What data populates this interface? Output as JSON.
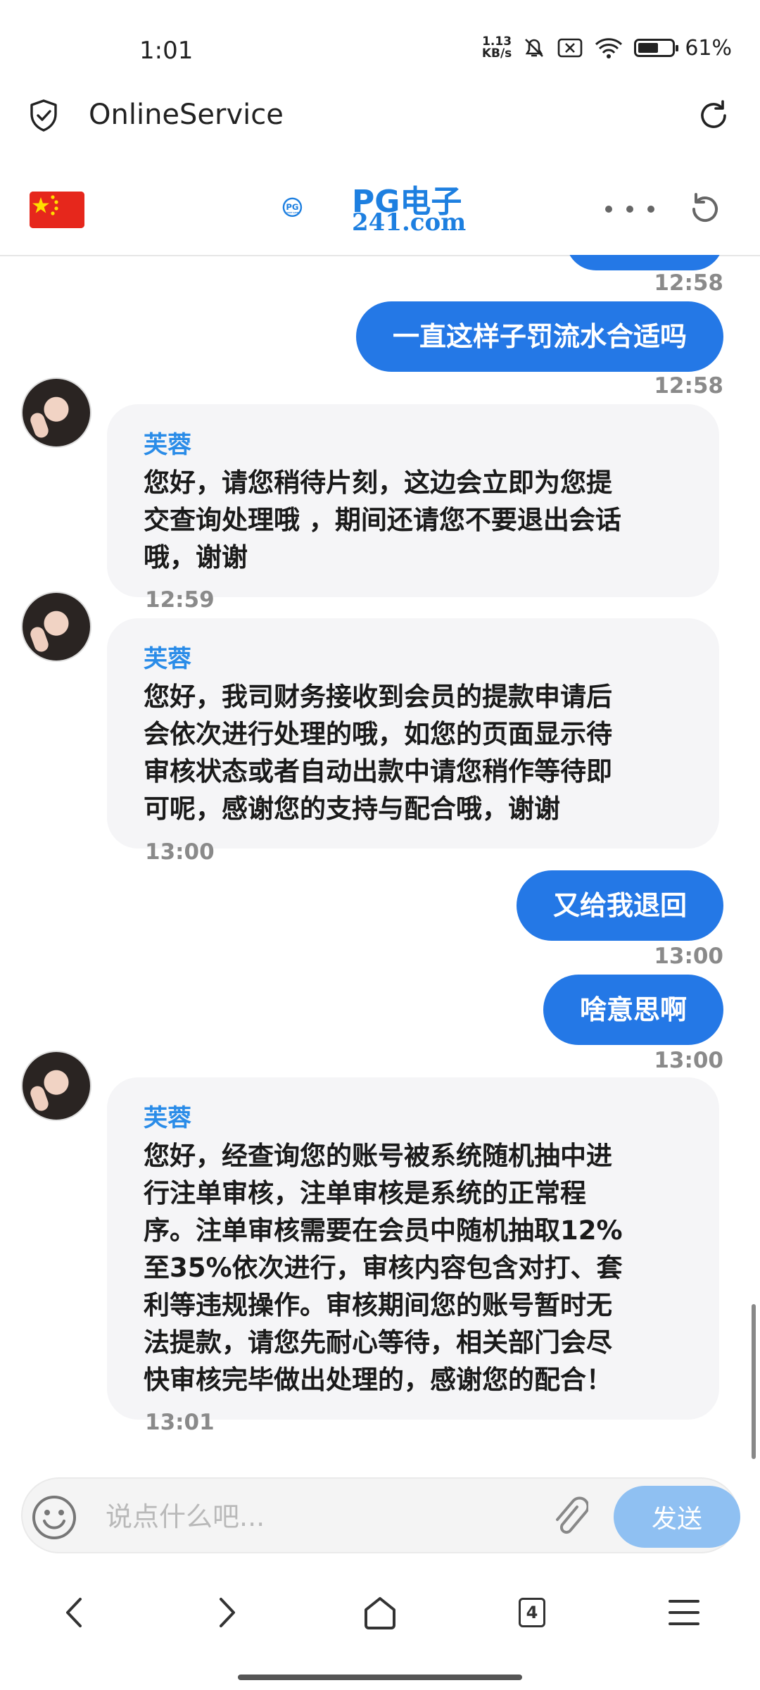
{
  "status_bar": {
    "time": "1:01",
    "net_speed_value": "1.13",
    "net_speed_unit": "KB/s",
    "battery": "61%",
    "battery_level": 0.61
  },
  "address_bar": {
    "title": "OnlineService"
  },
  "chat_header": {
    "logo_top": "PG电子",
    "logo_bottom": "241.com",
    "logo_badge": "PG",
    "logo_badge_sub": "POCKET GAMES"
  },
  "messages": [
    {
      "side": "right",
      "text": "一直这样子罚流水合适吗",
      "time": "12:58"
    },
    {
      "side": "left",
      "sender": "芙蓉",
      "lines": [
        "您好，请您稍待片刻，这边会立即为您提",
        "交查询处理哦 ，期间还请您不要退出会话",
        "哦，谢谢"
      ],
      "time": "12:59"
    },
    {
      "side": "left",
      "sender": "芙蓉",
      "lines": [
        "您好，我司财务接收到会员的提款申请后",
        "会依次进行处理的哦，如您的页面显示待",
        "审核状态或者自动出款中请您稍作等待即",
        "可呢，感谢您的支持与配合哦，谢谢"
      ],
      "time": "13:00"
    },
    {
      "side": "right",
      "text": "又给我退回",
      "time": "13:00"
    },
    {
      "side": "right",
      "text": "啥意思啊",
      "time": "13:00"
    },
    {
      "side": "left",
      "sender": "芙蓉",
      "lines": [
        "您好，经查询您的账号被系统随机抽中进",
        "行注单审核，注单审核是系统的正常程",
        "序。注单审核需要在会员中随机抽取12%",
        "至35%依次进行，审核内容包含对打、套",
        "利等违规操作。审核期间您的账号暂时无",
        "法提款，请您先耐心等待，相关部门会尽",
        "快审核完毕做出处理的，感谢您的配合！"
      ],
      "time": "13:01"
    }
  ],
  "top_partial_time": "12:58",
  "composer": {
    "placeholder": "说点什么吧...",
    "send_label": "发送"
  },
  "nav": {
    "tabs_count": "4"
  }
}
